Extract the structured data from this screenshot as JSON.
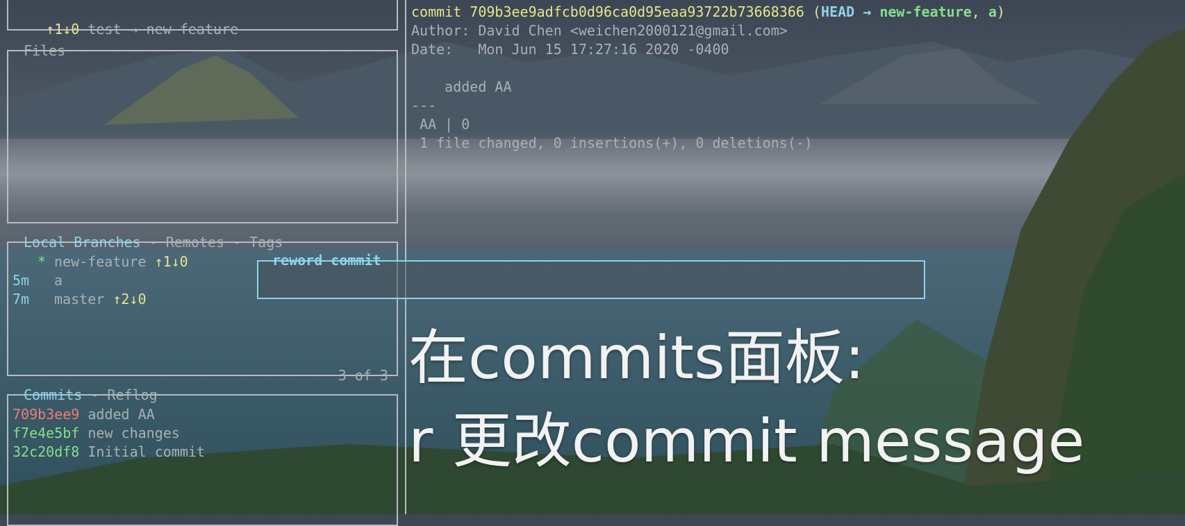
{
  "status": {
    "arrows": "↑1↓0",
    "text": "test → new-feature"
  },
  "files_panel": {
    "title": "Files"
  },
  "branches_panel": {
    "title_active": "Local Branches",
    "sep1": " - ",
    "title_2": "Remotes",
    "sep2": " - ",
    "title_3": "Tags",
    "footer": "3 of 3",
    "rows": [
      {
        "age": "*",
        "name": "new-feature",
        "track": "↑1↓0"
      },
      {
        "age": "5m",
        "name": "a",
        "track": ""
      },
      {
        "age": "7m",
        "name": "master",
        "track": "↑2↓0"
      }
    ]
  },
  "commits_panel": {
    "title_active": "Commits",
    "sep": " - ",
    "title_2": "Reflog",
    "rows": [
      {
        "hash": "709b3ee9",
        "msg": "added AA",
        "color": "#f07a7a"
      },
      {
        "hash": "f7e4e5bf",
        "msg": "new changes",
        "color": "#84df8a"
      },
      {
        "hash": "32c20df8",
        "msg": "Initial commit",
        "color": "#84df8a"
      }
    ]
  },
  "detail": {
    "commit_word": "commit 709b3ee9adfcb0d96ca0d95eaa93722b73668366",
    "paren_open": " (",
    "head": "HEAD",
    "arrow": " → ",
    "branch": "new-feature",
    "comma": ", ",
    "tag": "a",
    "paren_close": ")",
    "author": "Author: David Chen <weichen2000121@gmail.com>",
    "date": "Date:   Mon Jun 15 17:27:16 2020 -0400",
    "message": "    added AA",
    "sep": "---",
    "stat": " AA | 0",
    "summary": " 1 file changed, 0 insertions(+), 0 deletions(-)"
  },
  "reword_dialog": {
    "title": "reword commit",
    "value": ""
  },
  "caption": {
    "line1": "在commits面板:",
    "line2": "r 更改commit message"
  }
}
